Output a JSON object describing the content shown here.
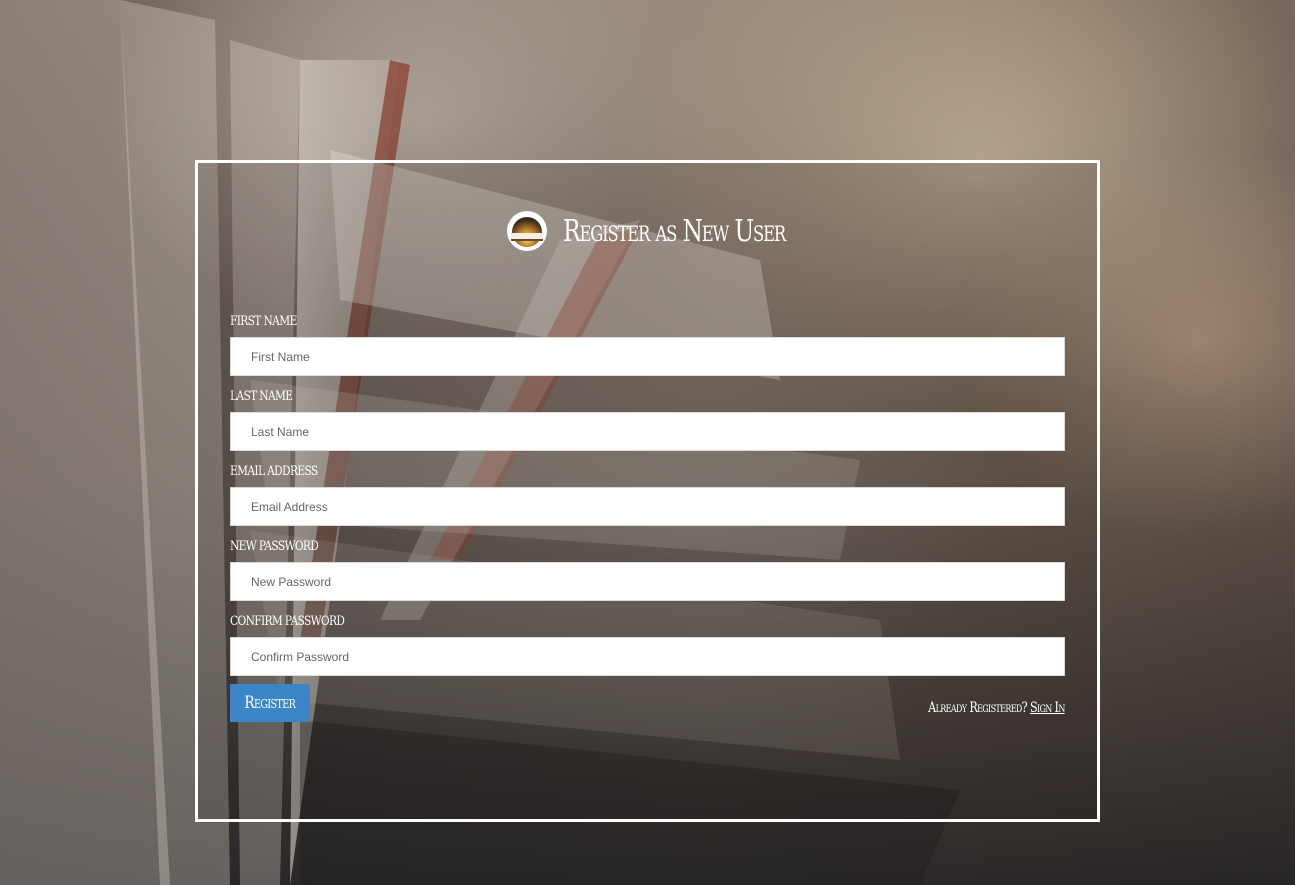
{
  "page": {
    "title": "Register as New User"
  },
  "form": {
    "fields": [
      {
        "label": "First Name",
        "placeholder": "First Name",
        "value": ""
      },
      {
        "label": "Last Name",
        "placeholder": "Last Name",
        "value": ""
      },
      {
        "label": "Email Address",
        "placeholder": "Email Address",
        "value": ""
      },
      {
        "label": "New Password",
        "placeholder": "New Password",
        "value": ""
      },
      {
        "label": "Confirm Password",
        "placeholder": "Confirm Password",
        "value": ""
      }
    ],
    "register_label": "Register",
    "already_registered_text": "Already Registered?",
    "sign_in_label": "Sign In"
  },
  "colors": {
    "accent": "#3b86c9",
    "panel_border": "#ffffff"
  },
  "icons": {
    "logo": "open-book-sunrise-icon"
  }
}
